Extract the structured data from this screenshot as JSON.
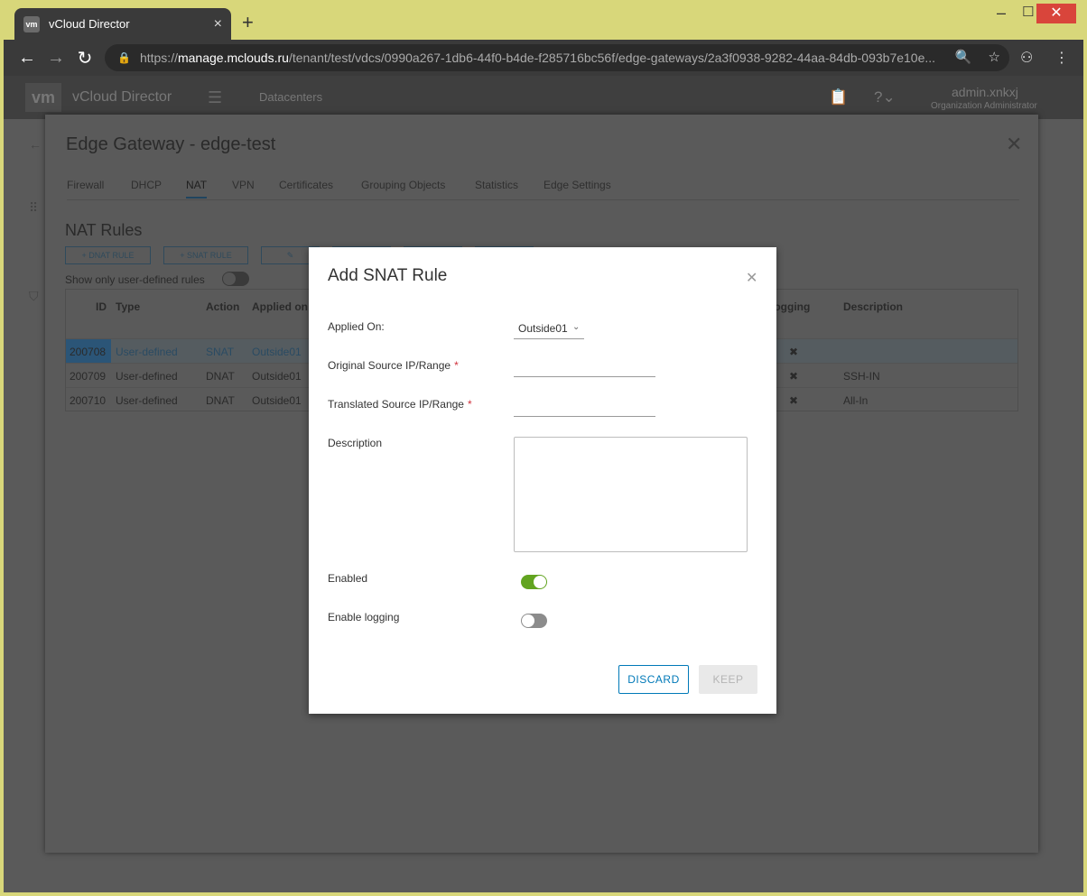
{
  "browser": {
    "tab_title": "vCloud Director",
    "favicon_text": "vm",
    "url_scheme": "https://",
    "url_host": "manage.mclouds.ru",
    "url_path": "/tenant/test/vdcs/0990a267-1db6-44f0-b4de-f285716bc56f/edge-gateways/2a3f0938-9282-44aa-84db-093b7e10e..."
  },
  "app": {
    "logo": "vm",
    "title": "vCloud Director",
    "nav_datacenters": "Datacenters",
    "user_name": "admin.xnkxj",
    "user_role": "Organization Administrator"
  },
  "edge": {
    "title": "Edge Gateway - edge-test",
    "tabs": [
      "Firewall",
      "DHCP",
      "NAT",
      "VPN",
      "Certificates",
      "Grouping Objects",
      "Statistics",
      "Edge Settings"
    ],
    "active_tab": "NAT",
    "nat_title": "NAT Rules",
    "btn_dnat": "+ DNAT RULE",
    "btn_snat": "+ SNAT RULE",
    "show_only_label": "Show only user-defined rules",
    "columns": {
      "id": "ID",
      "type": "Type",
      "action": "Action",
      "applied_on": "Applied on",
      "logging": "Logging",
      "description": "Description"
    },
    "rows": [
      {
        "id": "200708",
        "type": "User-defined",
        "action": "SNAT",
        "applied_on": "Outside01",
        "logging": "✖",
        "description": ""
      },
      {
        "id": "200709",
        "type": "User-defined",
        "action": "DNAT",
        "applied_on": "Outside01",
        "logging": "✖",
        "description": "SSH-IN"
      },
      {
        "id": "200710",
        "type": "User-defined",
        "action": "DNAT",
        "applied_on": "Outside01",
        "logging": "✖",
        "description": "All-In"
      }
    ]
  },
  "dialog": {
    "title": "Add SNAT Rule",
    "applied_on_label": "Applied On:",
    "applied_on_value": "Outside01",
    "original_source_label": "Original Source IP/Range",
    "translated_source_label": "Translated Source IP/Range",
    "required_mark": "*",
    "description_label": "Description",
    "enabled_label": "Enabled",
    "enabled": true,
    "logging_label": "Enable logging",
    "logging": false,
    "discard_label": "DISCARD",
    "keep_label": "KEEP",
    "accent_color": "#0079b8",
    "toggle_on_color": "#62a420"
  }
}
